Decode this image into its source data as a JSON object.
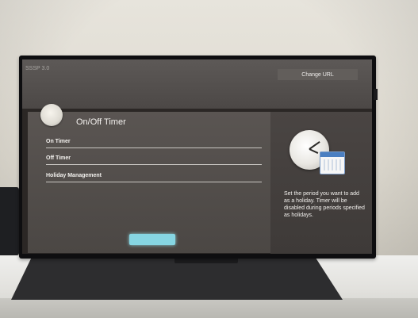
{
  "app_name": "SSSP 3.0",
  "header": {
    "change_url_label": "Change URL"
  },
  "timer": {
    "title": "On/Off Timer",
    "items": [
      "On Timer",
      "Off Timer",
      "Holiday Management"
    ]
  },
  "help": {
    "text": "Set the period you want to add as a holiday. Timer will be disabled during periods specified as holidays."
  },
  "icons": {
    "timer_icon": "timer-icon",
    "clock_icon": "clock-icon",
    "calendar_icon": "calendar-icon"
  },
  "colors": {
    "screen_bg": "#2b2725",
    "panel_bg": "#504b48",
    "accent": "#86d6e3"
  }
}
